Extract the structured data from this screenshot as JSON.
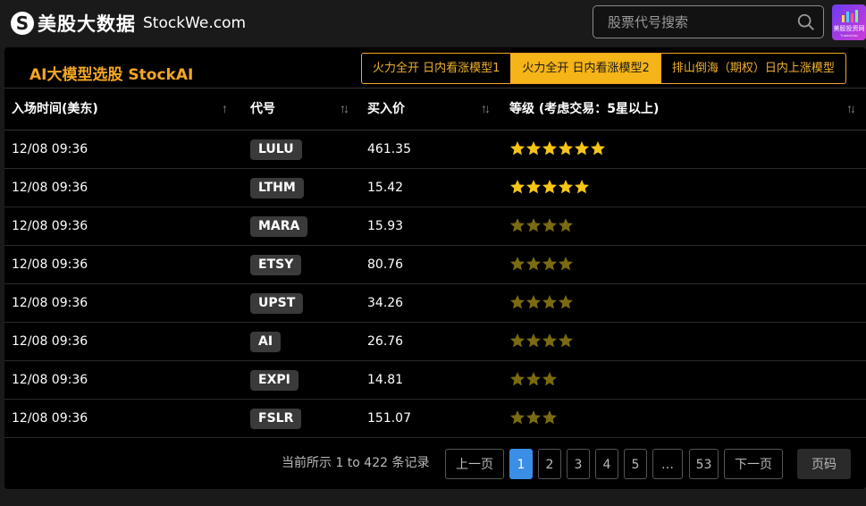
{
  "header": {
    "logo_mark": "S",
    "logo_cn": "美股大数据",
    "logo_en": "StockWe.com",
    "search_placeholder": "股票代号搜索",
    "app_badge_label": "美股投资网",
    "app_badge_sub": "TradesMax"
  },
  "panel": {
    "title": "AI大模型选股 StockAI",
    "tabs": [
      {
        "label": "火力全开 日内看涨模型1",
        "active": false
      },
      {
        "label": "火力全开 日内看涨模型2",
        "active": true
      },
      {
        "label": "排山倒海（期权）日内上涨模型",
        "active": false
      }
    ]
  },
  "table": {
    "columns": [
      {
        "label": "入场时间(美东)",
        "sort": "↑"
      },
      {
        "label": "代号",
        "sort": "↑↓"
      },
      {
        "label": "买入价",
        "sort": "↑↓"
      },
      {
        "label": "等级 (考虑交易：5星以上)",
        "sort": "↑↓"
      }
    ],
    "rows": [
      {
        "time": "12/08 09:36",
        "code": "LULU",
        "price": "461.35",
        "stars": 6,
        "star_color": "#f5c518"
      },
      {
        "time": "12/08 09:36",
        "code": "LTHM",
        "price": "15.42",
        "stars": 5,
        "star_color": "#f5c518"
      },
      {
        "time": "12/08 09:36",
        "code": "MARA",
        "price": "15.93",
        "stars": 4,
        "star_color": "#7a6a12"
      },
      {
        "time": "12/08 09:36",
        "code": "ETSY",
        "price": "80.76",
        "stars": 4,
        "star_color": "#7a6a12"
      },
      {
        "time": "12/08 09:36",
        "code": "UPST",
        "price": "34.26",
        "stars": 4,
        "star_color": "#7a6a12"
      },
      {
        "time": "12/08 09:36",
        "code": "AI",
        "price": "26.76",
        "stars": 4,
        "star_color": "#7a6a12"
      },
      {
        "time": "12/08 09:36",
        "code": "EXPI",
        "price": "14.81",
        "stars": 3,
        "star_color": "#7a6a12"
      },
      {
        "time": "12/08 09:36",
        "code": "FSLR",
        "price": "151.07",
        "stars": 3,
        "star_color": "#7a6a12"
      }
    ]
  },
  "pagination": {
    "info": "当前所示 1 to 422 条记录",
    "prev": "上一页",
    "pages": [
      "1",
      "2",
      "3",
      "4",
      "5",
      "…",
      "53"
    ],
    "current": "1",
    "next": "下一页",
    "jump": "页码"
  },
  "colors": {
    "accent": "#f5a623",
    "active_tab_bg": "#f5b417",
    "page_active": "#3a8ee6",
    "star_bright": "#f5c518",
    "star_dim": "#7a6a12"
  }
}
